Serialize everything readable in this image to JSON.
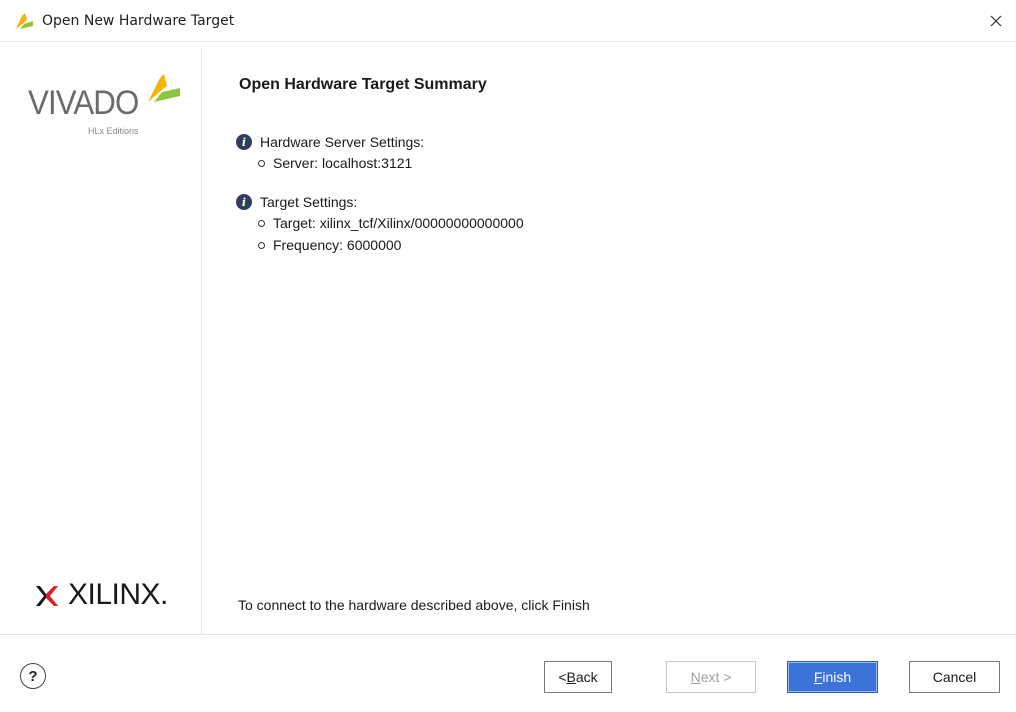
{
  "window": {
    "title": "Open New Hardware Target",
    "close_icon": "close-icon"
  },
  "sidebar": {
    "vivado_logo_text": "VIVADO",
    "vivado_subtitle": "HLx Editions",
    "xilinx_logo_text": "XILINX."
  },
  "main": {
    "title": "Open Hardware Target Summary",
    "sections": [
      {
        "label": "Hardware Server Settings:",
        "items": [
          "Server: localhost:3121"
        ]
      },
      {
        "label": "Target Settings:",
        "items": [
          "Target: xilinx_tcf/Xilinx/00000000000000",
          "Frequency: 6000000"
        ]
      }
    ],
    "footer_note": "To connect to the hardware described above, click Finish"
  },
  "buttons": {
    "help": "?",
    "back_prefix": "< ",
    "back_key": "B",
    "back_rest": "ack",
    "next_key": "N",
    "next_rest": "ext >",
    "finish_key": "F",
    "finish_rest": "inish",
    "cancel": "Cancel"
  },
  "colors": {
    "accent": "#3b73d9",
    "info_icon": "#2f3e5c",
    "vivado_green": "#8cc63f",
    "vivado_yellow": "#f5b400",
    "xilinx_red": "#d2232a"
  }
}
